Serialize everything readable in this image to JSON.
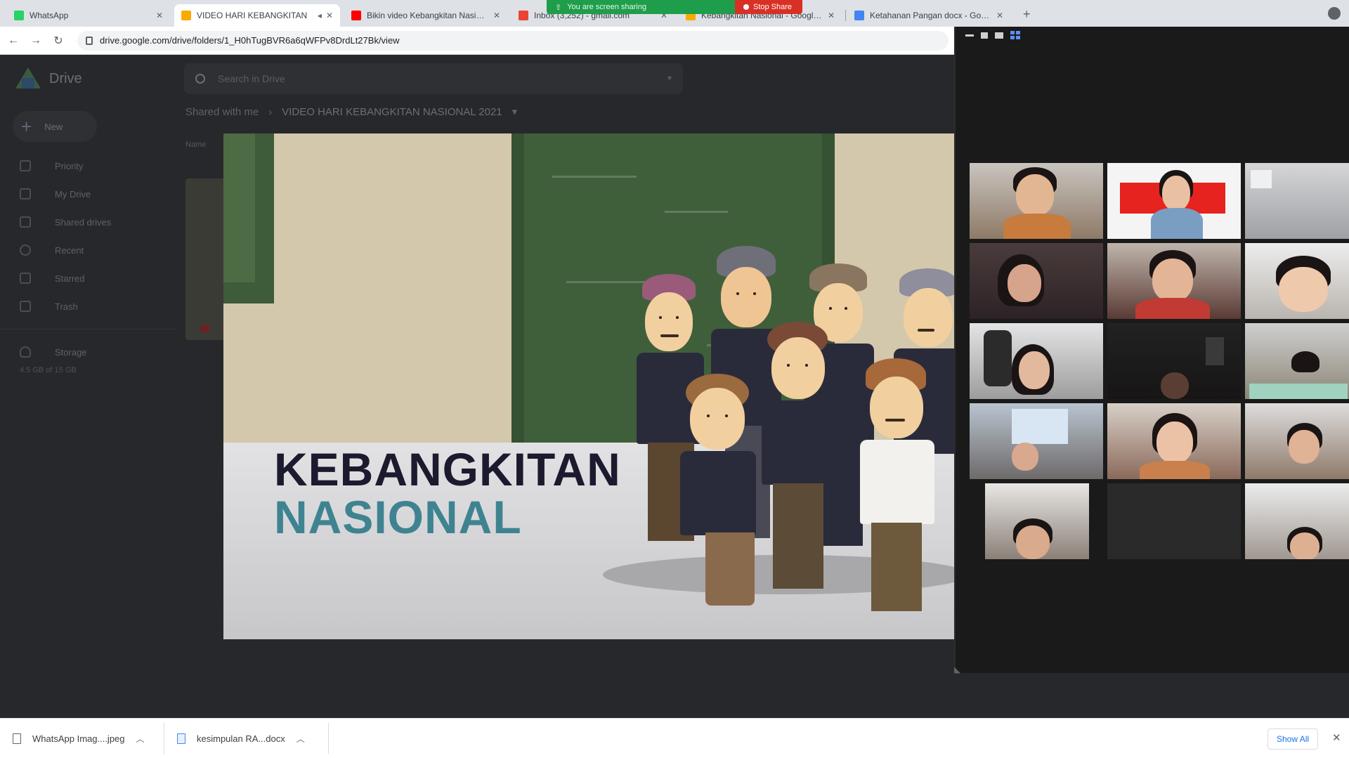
{
  "tabs": [
    {
      "title": "WhatsApp",
      "favicon_color": "#25d366",
      "active": false
    },
    {
      "title": "VIDEO HARI KEBANGKITAN",
      "favicon_color": "#f9ab00",
      "active": true
    },
    {
      "title": "Bikin video Kebangkitan Nasional",
      "favicon_color": "#ff0000",
      "active": false
    },
    {
      "title": "Inbox (3,252) - gmail.com",
      "favicon_color": "#ea4335",
      "active": false
    },
    {
      "title": "Kebangkitan Nasional - Google Drive",
      "favicon_color": "#f9ab00",
      "active": false
    },
    {
      "title": "Ketahanan Pangan docx - Goo...",
      "favicon_color": "#4285f4",
      "active": false
    }
  ],
  "sharing": {
    "status": "You are screen sharing",
    "stop_label": "Stop Share"
  },
  "address": {
    "url": "drive.google.com/drive/folders/1_H0hTugBVR6a6qWFPv8DrdLt27Bk/view"
  },
  "drive": {
    "app_name": "Drive",
    "search_placeholder": "Search in Drive",
    "new_label": "New",
    "sidebar": [
      {
        "label": "Priority",
        "icon": "priority-icon"
      },
      {
        "label": "My Drive",
        "icon": "my-drive-icon"
      },
      {
        "label": "Shared drives",
        "icon": "shared-drives-icon"
      },
      {
        "label": "Recent",
        "icon": "recent-icon"
      },
      {
        "label": "Starred",
        "icon": "starred-icon"
      },
      {
        "label": "Trash",
        "icon": "trash-icon"
      }
    ],
    "storage_label": "Storage",
    "storage_used": "4.5 GB of 15 GB",
    "breadcrumb_root": "Shared with me",
    "breadcrumb_current": "VIDEO HARI KEBANGKITAN NASIONAL 2021",
    "sort_label": "Name"
  },
  "slide": {
    "title_line1": "KEBANGKITAN",
    "title_line2": "NASIONAL"
  },
  "downloads": [
    {
      "name": "WhatsApp Imag....jpeg",
      "icon": "image-file-icon"
    },
    {
      "name": "kesimpulan RA...docx",
      "icon": "doc-file-icon"
    }
  ],
  "downloads_show_all": "Show All",
  "colors": {
    "share_green": "#1e9e4a",
    "share_red": "#d93025",
    "highlight": "#f3e35a",
    "title_dark": "#1b1a2e",
    "title_teal": "#3f8391"
  }
}
